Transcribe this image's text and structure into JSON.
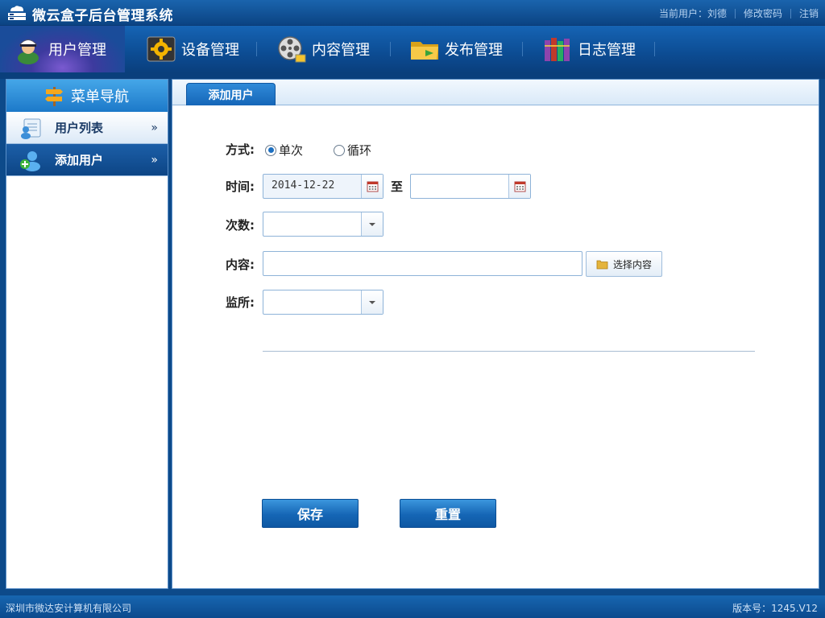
{
  "header": {
    "app_title": "微云盒子后台管理系统",
    "current_user": "当前用户：刘德",
    "change_password": "修改密码",
    "logout": "注销"
  },
  "nav": {
    "items": [
      {
        "label": "用户管理",
        "icon": "user-avatar-icon",
        "active": true
      },
      {
        "label": "设备管理",
        "icon": "gear-icon",
        "active": false
      },
      {
        "label": "内容管理",
        "icon": "film-reel-icon",
        "active": false
      },
      {
        "label": "发布管理",
        "icon": "folder-icon",
        "active": false
      },
      {
        "label": "日志管理",
        "icon": "books-icon",
        "active": false
      }
    ]
  },
  "sidebar": {
    "title": "菜单导航",
    "items": [
      {
        "label": "用户列表",
        "icon": "user-list-icon",
        "active": false
      },
      {
        "label": "添加用户",
        "icon": "add-user-icon",
        "active": true
      }
    ]
  },
  "tab": {
    "label": "添加用户"
  },
  "form": {
    "mode_label": "方式:",
    "mode_options": [
      "单次",
      "循环"
    ],
    "mode_selected": "单次",
    "time_label": "时间:",
    "start_date": "2014-12-22",
    "to_label": "至",
    "end_date": "",
    "count_label": "次数:",
    "count_value": "",
    "content_label": "内容:",
    "content_value": "",
    "choose_content": "选择内容",
    "station_label": "监所:",
    "station_value": "",
    "save": "保存",
    "reset": "重置"
  },
  "footer": {
    "company": "深圳市微达安计算机有限公司",
    "version": "版本号：1245.V12"
  },
  "colors": {
    "primary": "#0d4a8a",
    "accent": "#1566b8",
    "radio_selected": "#1c6fc1"
  }
}
